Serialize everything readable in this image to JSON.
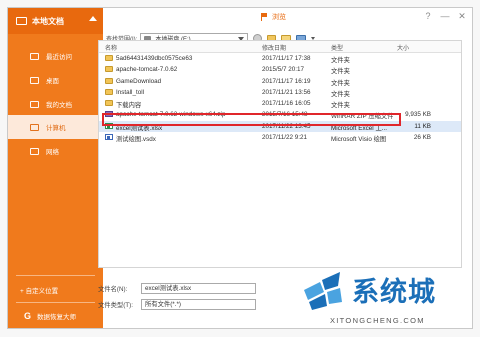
{
  "sidebar": {
    "title": "本地文档",
    "items": [
      {
        "label": "最近访问",
        "icon": "recent-icon"
      },
      {
        "label": "桌面",
        "icon": "desktop-icon"
      },
      {
        "label": "我的文档",
        "icon": "documents-icon"
      },
      {
        "label": "计算机",
        "icon": "computer-icon",
        "active": true
      },
      {
        "label": "网络",
        "icon": "network-icon"
      }
    ],
    "add_location": "+ 自定义位置",
    "data_recovery": "数据恢复大师"
  },
  "dialog": {
    "title": "浏览",
    "path_label": "查找范围(I):",
    "path_value": "本地磁盘 (E:)",
    "window_buttons": [
      "?",
      "—",
      "✕"
    ]
  },
  "list": {
    "columns": [
      "名称",
      "修改日期",
      "类型",
      "大小"
    ],
    "rows": [
      {
        "name": "5ad6443143​9dbc0575ce63",
        "date": "2017/11/17 17:38",
        "type": "文件夹",
        "size": "",
        "icon": "folder"
      },
      {
        "name": "apache-tomcat-7.0.62",
        "date": "2015/5/7 20:17",
        "type": "文件夹",
        "size": "",
        "icon": "folder"
      },
      {
        "name": "GameDownload",
        "date": "2017/11/17 16:19",
        "type": "文件夹",
        "size": "",
        "icon": "folder"
      },
      {
        "name": "Install_toll",
        "date": "2017/11/21 13:56",
        "type": "文件夹",
        "size": "",
        "icon": "folder"
      },
      {
        "name": "下载内容",
        "date": "2017/11/16 16:05",
        "type": "文件夹",
        "size": "",
        "icon": "folder"
      },
      {
        "name": "apache-tomcat-7.0.62-windows-x64.zip",
        "date": "2015/7/16 15:48",
        "type": "WinRAR ZIP 压缩文件",
        "size": "9,935 KB",
        "icon": "zip"
      },
      {
        "name": "excel测试表.xlsx",
        "date": "2017/11/22 13:45",
        "type": "Microsoft Excel 工...",
        "size": "11 KB",
        "icon": "xls",
        "selected": true
      },
      {
        "name": "测试绘图.vsdx",
        "date": "2017/11/22 9:21",
        "type": "Microsoft Visio 绘图",
        "size": "26 KB",
        "icon": "vsd"
      }
    ]
  },
  "fields": {
    "filename_label": "文件名(N):",
    "filename_value": "excel测试表.xlsx",
    "filetype_label": "文件类型(T):",
    "filetype_value": "所有文件(*.*)"
  },
  "watermark": {
    "text": "系统城",
    "url": "XITONGCHENG.COM"
  }
}
